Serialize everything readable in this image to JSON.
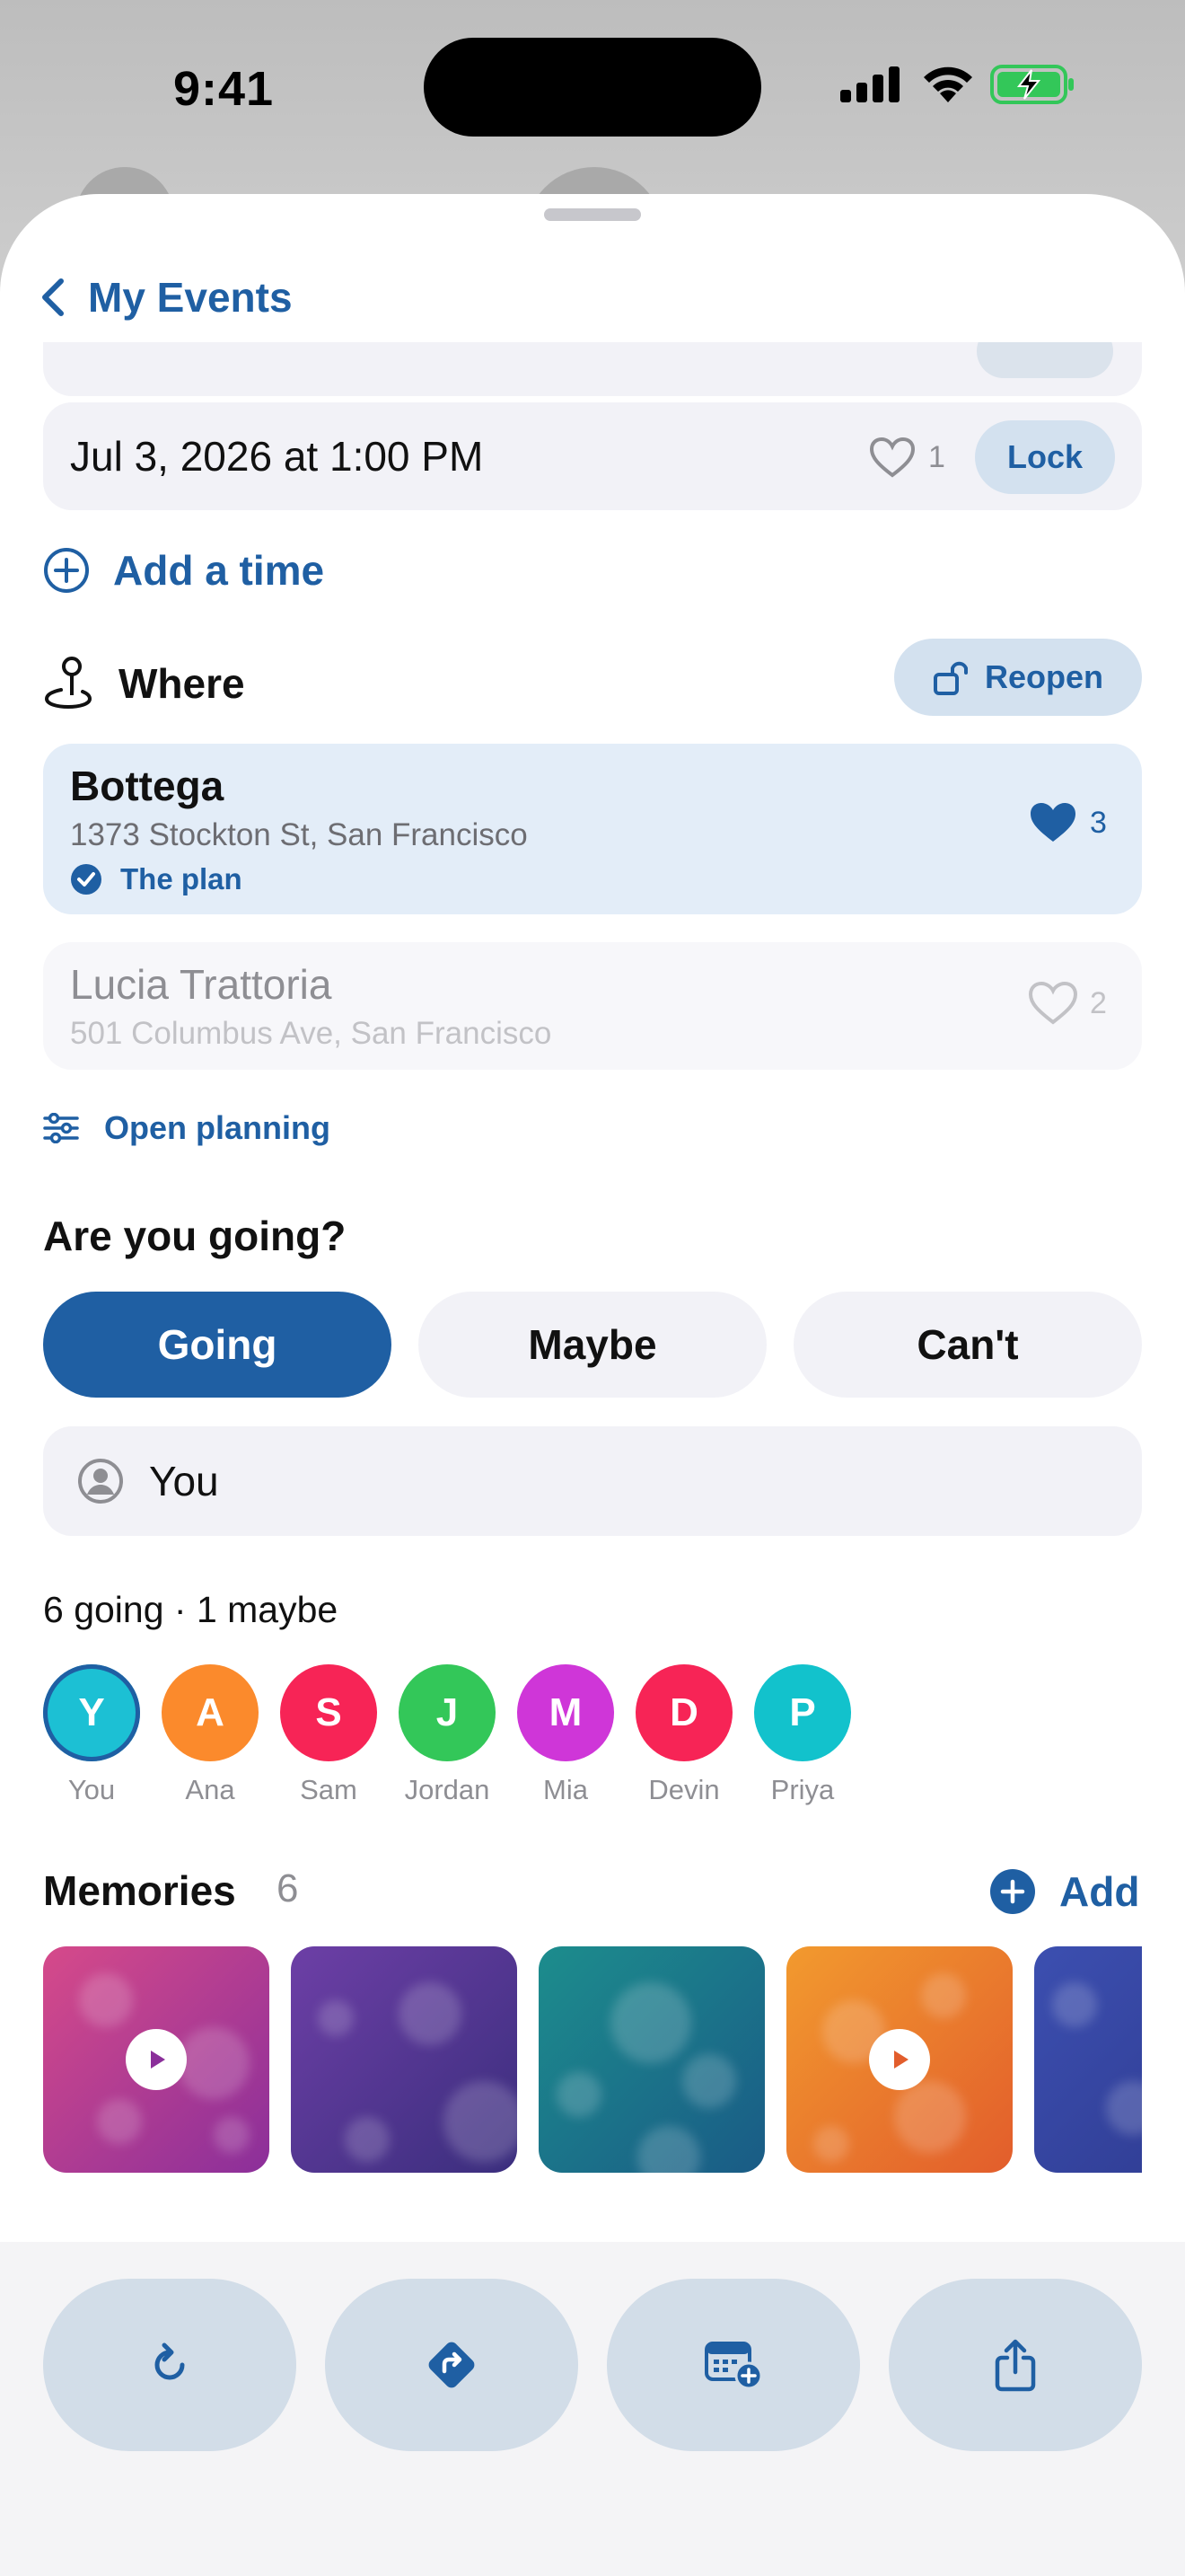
{
  "status_bar": {
    "time": "9:41"
  },
  "nav": {
    "back_label": "My Events"
  },
  "when": {
    "option": {
      "label": "Jul 3, 2026 at 1:00 PM",
      "likes": "1",
      "lock_label": "Lock"
    },
    "add_time_label": "Add a time"
  },
  "where": {
    "title": "Where",
    "reopen_label": "Reopen",
    "places": [
      {
        "name": "Bottega",
        "address": "1373 Stockton St, San Francisco",
        "likes": "3",
        "badge": "The plan",
        "selected": true
      },
      {
        "name": "Lucia Trattoria",
        "address": "501 Columbus Ave, San Francisco",
        "likes": "2",
        "selected": false
      }
    ],
    "open_planning_label": "Open planning"
  },
  "rsvp": {
    "title": "Are you going?",
    "options": [
      "Going",
      "Maybe",
      "Can't"
    ],
    "selected": "Going",
    "respondent": "You"
  },
  "attendees": {
    "summary": "6 going · 1 maybe",
    "people": [
      {
        "initial": "Y",
        "name": "You",
        "color": "#1cc0d4"
      },
      {
        "initial": "A",
        "name": "Ana",
        "color": "#fb8a2c"
      },
      {
        "initial": "S",
        "name": "Sam",
        "color": "#f72456"
      },
      {
        "initial": "J",
        "name": "Jordan",
        "color": "#33c759"
      },
      {
        "initial": "M",
        "name": "Mia",
        "color": "#cf36d8"
      },
      {
        "initial": "D",
        "name": "Devin",
        "color": "#f72456"
      },
      {
        "initial": "P",
        "name": "Priya",
        "color": "#12c2cc"
      }
    ]
  },
  "memories": {
    "title": "Memories",
    "count": "6",
    "add_label": "Add",
    "thumbnails": [
      {
        "video": true,
        "gradient": [
          "#d64a8a",
          "#8b2f9a"
        ]
      },
      {
        "video": false,
        "gradient": [
          "#6d3fa6",
          "#3a2e7d"
        ]
      },
      {
        "video": false,
        "gradient": [
          "#1c8d8d",
          "#1a5b86"
        ]
      },
      {
        "video": true,
        "gradient": [
          "#f29a2e",
          "#e25d2c"
        ]
      },
      {
        "video": false,
        "gradient": [
          "#3c4fb0",
          "#2e3a8f"
        ]
      }
    ]
  },
  "toolbar": {
    "actions": [
      "refresh-icon",
      "directions-icon",
      "add-to-calendar-icon",
      "share-icon"
    ]
  },
  "colors": {
    "accent": "#1f5fa3",
    "selected_card": "#e3edf8",
    "card": "#f2f2f7"
  }
}
